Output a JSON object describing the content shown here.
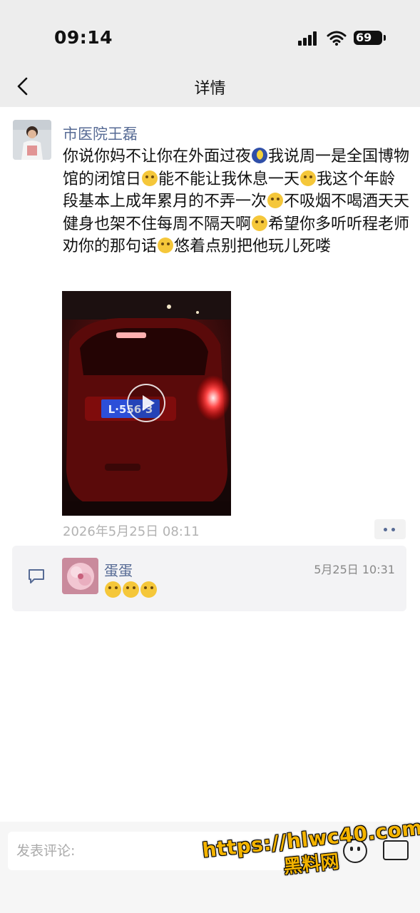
{
  "status_bar": {
    "time": "09:14",
    "battery": "69"
  },
  "nav": {
    "title": "详情"
  },
  "post": {
    "author": "市医院王磊",
    "text_segments": [
      "你说你妈不让你在外面过夜",
      "我说周一是全国博物馆的闭馆日",
      "能不能让我休息一天",
      "我这个年龄段基本上成年累月的不弄一次",
      "不吸烟不喝酒天天健身也架不住每周不隔天啊",
      "希望你多听听程老师劝你的那句话",
      "悠着点别把他玩儿死喽"
    ],
    "emojis": [
      "moon-face-emoji",
      "crying-laughing-emoji",
      "sweat-emoji",
      "tears-of-joy-emoji",
      "eye-roll-emoji",
      "monocle-emoji"
    ],
    "media": {
      "type": "video",
      "plate_text": "L·556·3"
    },
    "date": "2026年5月25日 08:11"
  },
  "comments": [
    {
      "name": "蛋蛋",
      "time": "5月25日 10:31",
      "emojis": [
        "thinking-emoji",
        "thinking-emoji",
        "thinking-emoji"
      ]
    }
  ],
  "bottom_bar": {
    "placeholder": "发表评论:"
  },
  "watermark": {
    "line1": "https://hlwc40.com",
    "line2": "黑料网"
  },
  "colors": {
    "link": "#576b95",
    "bar_bg": "#ededed",
    "watermark": "#f4b400"
  }
}
